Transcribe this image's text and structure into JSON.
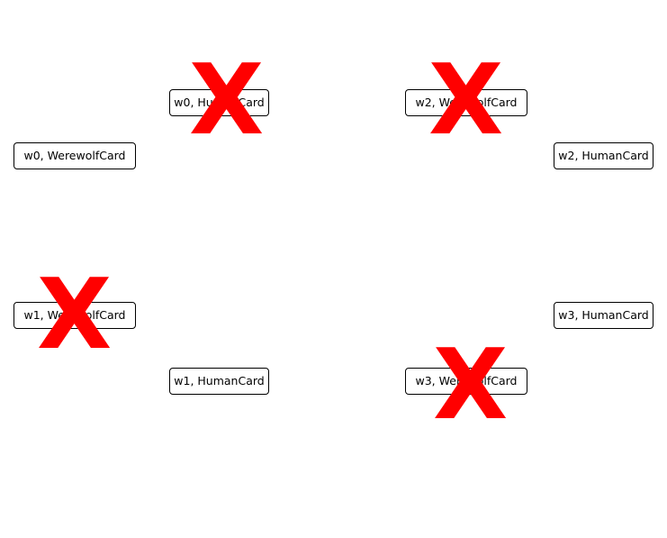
{
  "cards": [
    {
      "label": "w0, HumanCard",
      "eliminated": true
    },
    {
      "label": "w2, WerewolfCard",
      "eliminated": true
    },
    {
      "label": "w0, WerewolfCard",
      "eliminated": false
    },
    {
      "label": "w2, HumanCard",
      "eliminated": false
    },
    {
      "label": "w1, WerewolfCard",
      "eliminated": true
    },
    {
      "label": "w3, HumanCard",
      "eliminated": false
    },
    {
      "label": "w1, HumanCard",
      "eliminated": false
    },
    {
      "label": "w3, WerewolfCard",
      "eliminated": true
    }
  ],
  "marks": {
    "eliminated_symbol": "X",
    "eliminated_color": "#ff0000"
  }
}
